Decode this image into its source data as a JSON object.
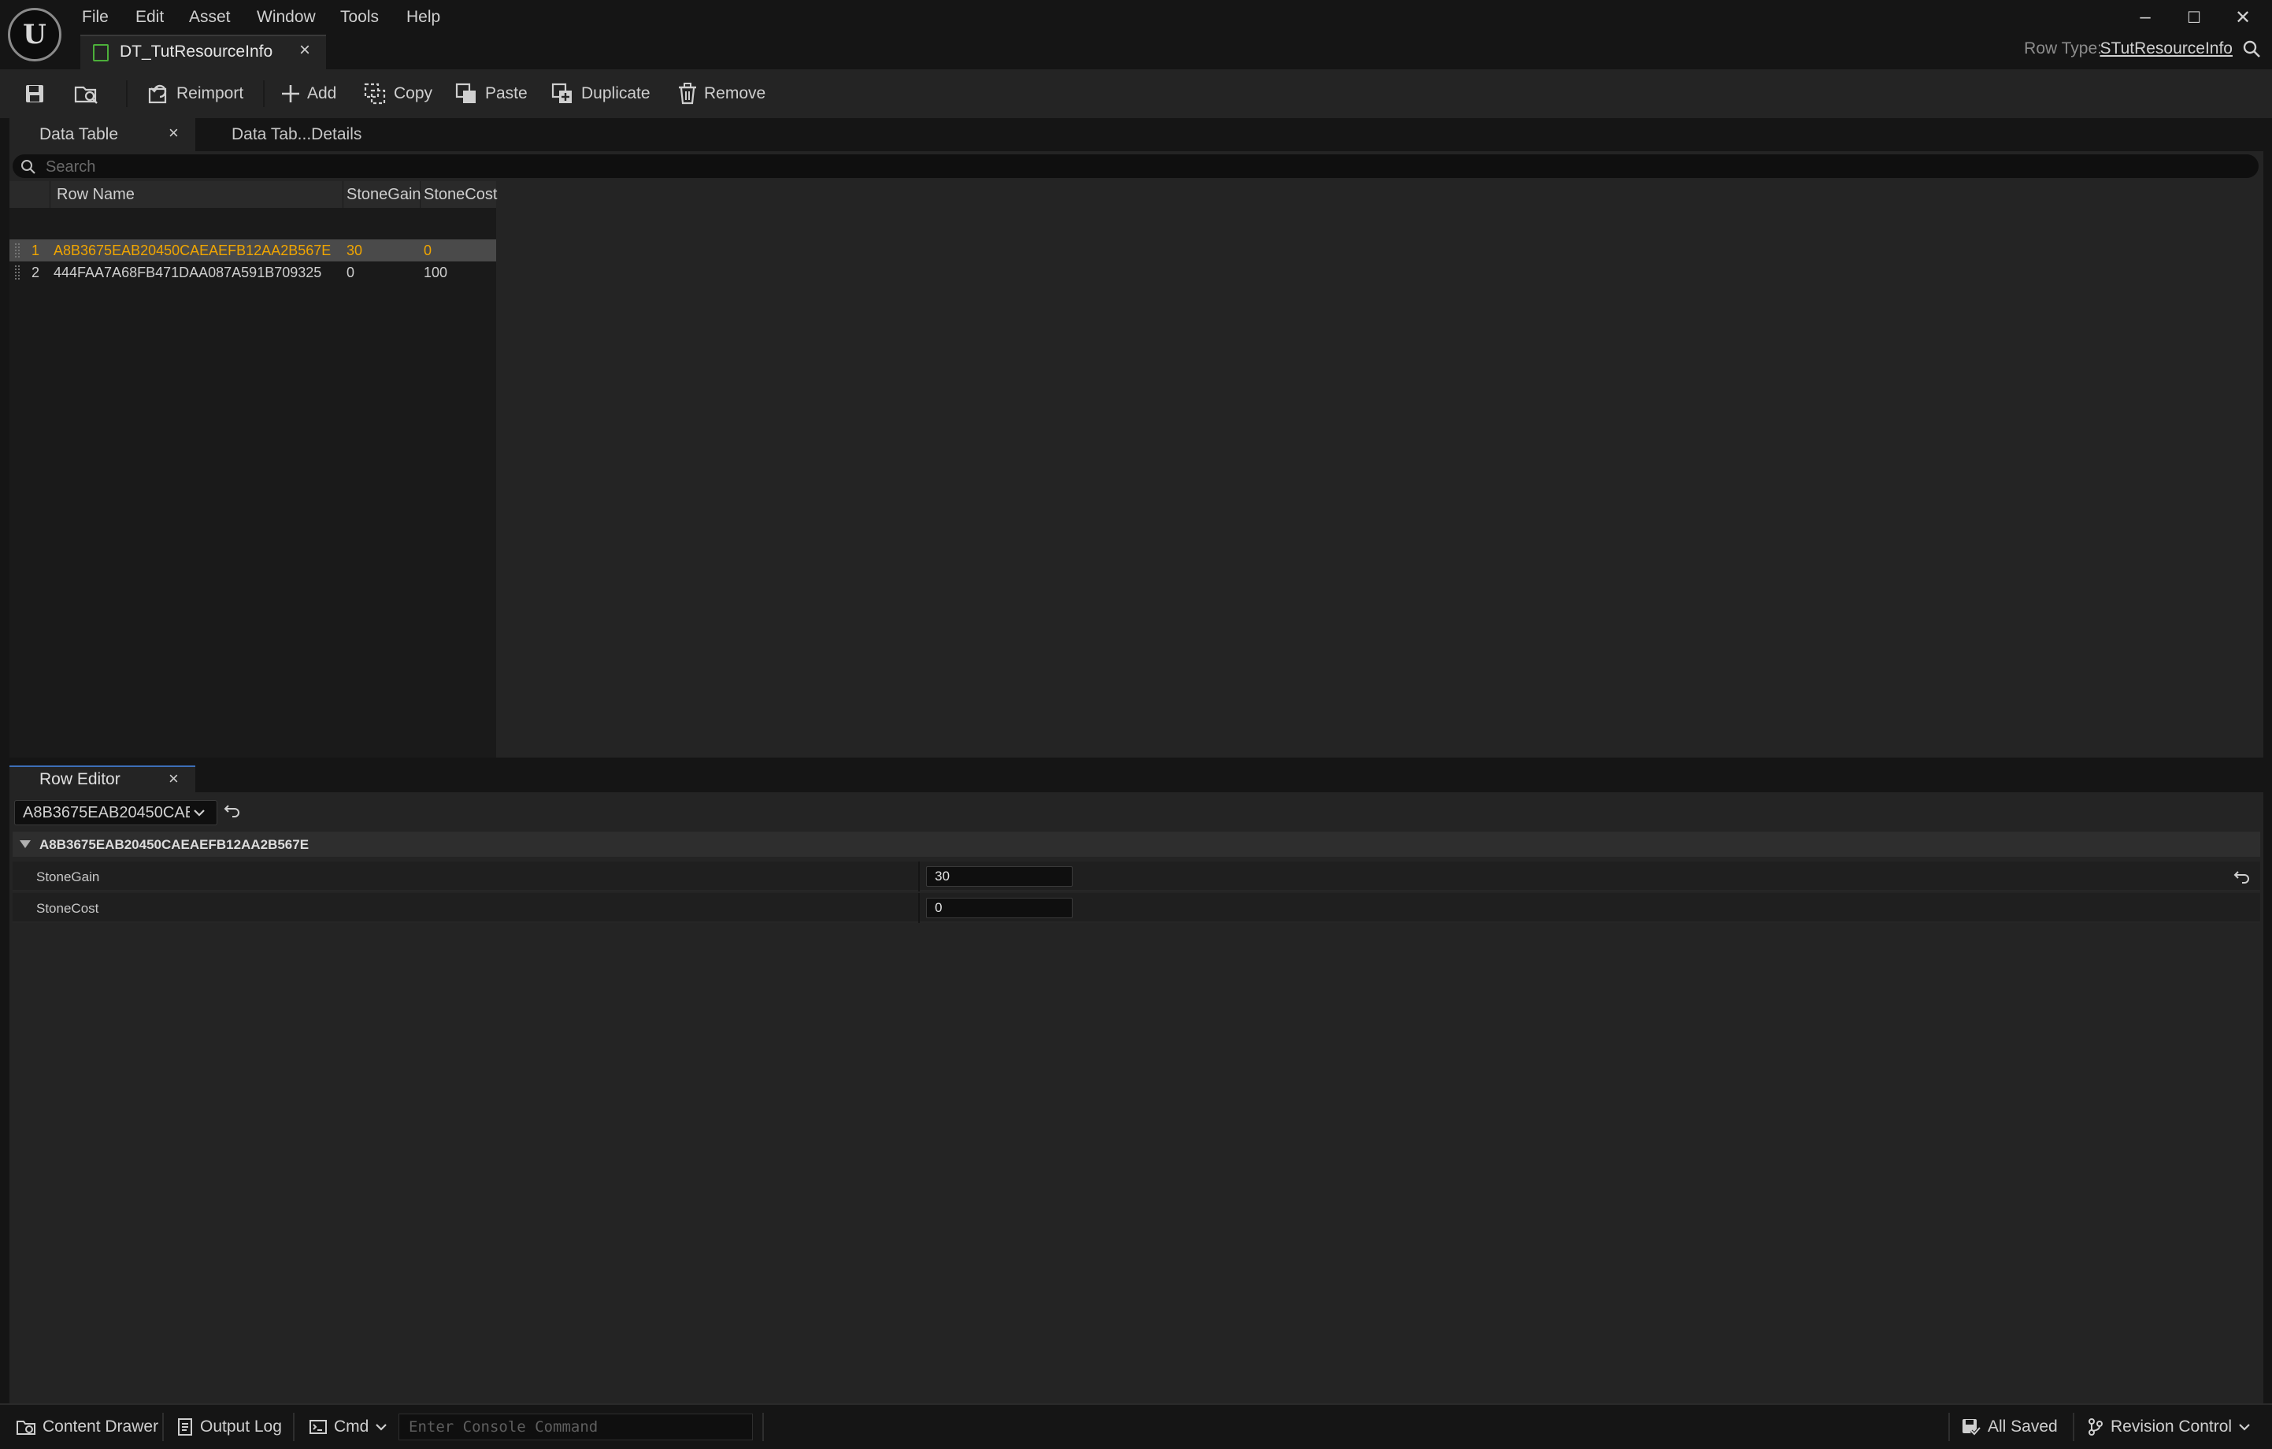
{
  "app": {
    "logo": "U",
    "menu": [
      "File",
      "Edit",
      "Asset",
      "Window",
      "Tools",
      "Help"
    ],
    "document_tab": "DT_TutResourceInfo",
    "close_glyph": "×",
    "window_controls": {
      "minimize": "–",
      "maximize": "☐",
      "close": "✕"
    },
    "row_type_label": "Row Type:",
    "row_type_value": "STutResourceInfo"
  },
  "toolbar": {
    "reimport": "Reimport",
    "add": "Add",
    "copy": "Copy",
    "paste": "Paste",
    "duplicate": "Duplicate",
    "remove": "Remove"
  },
  "data_table_panel": {
    "tabs": [
      "Data Table",
      "Data Tab...Details"
    ],
    "search_placeholder": "Search",
    "columns": [
      "Row Name",
      "StoneGain",
      "StoneCost"
    ],
    "rows": [
      {
        "index": "1",
        "name": "A8B3675EAB20450CAEAEFB12AA2B567E",
        "stone_gain": "30",
        "stone_cost": "0",
        "selected": true
      },
      {
        "index": "2",
        "name": "444FAA7A68FB471DAA087A591B709325",
        "stone_gain": "0",
        "stone_cost": "100",
        "selected": false
      }
    ]
  },
  "row_editor": {
    "tab": "Row Editor",
    "selected_row": "A8B3675EAB20450CAEAEFB12AA2B567E",
    "category": "A8B3675EAB20450CAEAEFB12AA2B567E",
    "properties": [
      {
        "label": "StoneGain",
        "value": "30"
      },
      {
        "label": "StoneCost",
        "value": "0"
      }
    ]
  },
  "status_bar": {
    "content_drawer": "Content Drawer",
    "output_log": "Output Log",
    "cmd": "Cmd",
    "console_placeholder": "Enter Console Command",
    "all_saved": "All Saved",
    "revision_control": "Revision Control"
  },
  "colors": {
    "accent_selected_text": "#f0a500",
    "data_table_icon": "#4caf3a",
    "active_tab_accent": "#3d6fb8",
    "panel_bg": "#242424",
    "window_bg": "#151515"
  }
}
